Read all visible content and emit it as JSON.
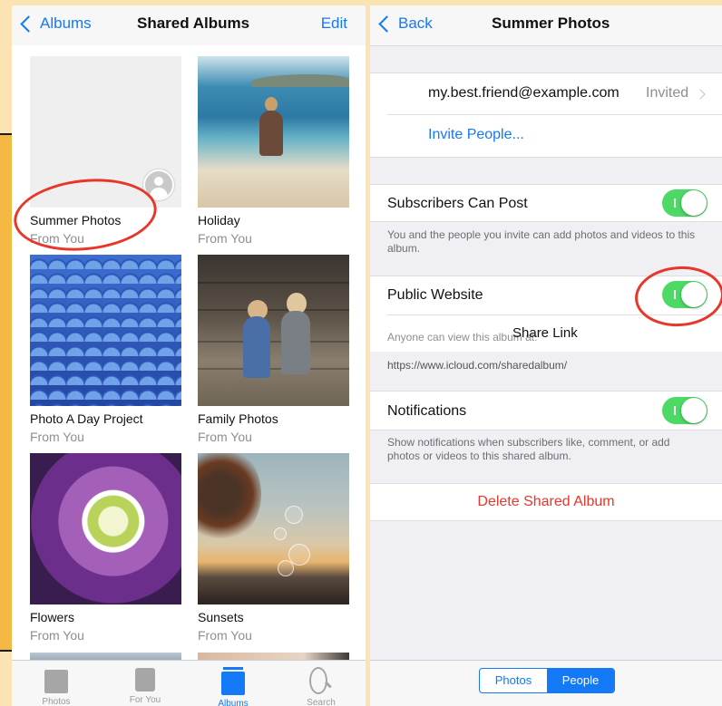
{
  "left": {
    "nav": {
      "back_label": "Albums",
      "title": "Shared Albums",
      "edit_label": "Edit"
    },
    "albums": [
      {
        "name": "Summer Photos",
        "owner": "From You"
      },
      {
        "name": "Holiday",
        "owner": "From You"
      },
      {
        "name": "Photo A Day Project",
        "owner": "From You"
      },
      {
        "name": "Family Photos",
        "owner": "From You"
      },
      {
        "name": "Flowers",
        "owner": "From You"
      },
      {
        "name": "Sunsets",
        "owner": "From You"
      }
    ],
    "tabs": [
      {
        "label": "Photos",
        "icon": "photos-icon"
      },
      {
        "label": "For You",
        "icon": "for-you-icon"
      },
      {
        "label": "Albums",
        "icon": "albums-icon",
        "active": true
      },
      {
        "label": "Search",
        "icon": "search-icon"
      }
    ]
  },
  "right": {
    "nav": {
      "back_label": "Back",
      "title": "Summer Photos"
    },
    "invitee": {
      "email": "my.best.friend@example.com",
      "status": "Invited"
    },
    "invite_label": "Invite People...",
    "subscribers_can_post": {
      "label": "Subscribers Can Post",
      "on": true,
      "footer": "You and the people you invite can add photos and videos to this album."
    },
    "public_website": {
      "label": "Public Website",
      "on": true,
      "footer": "Anyone can view this album at:",
      "share_link_label": "Share Link",
      "url": "https://www.icloud.com/sharedalbum/"
    },
    "notifications": {
      "label": "Notifications",
      "on": true,
      "footer": "Show notifications when subscribers like, comment, or add photos or videos to this shared album."
    },
    "delete_label": "Delete Shared Album",
    "segments": [
      {
        "label": "Photos",
        "selected": false
      },
      {
        "label": "People",
        "selected": true
      }
    ]
  },
  "colors": {
    "accent": "#1479f6",
    "toggle_on": "#4cd964",
    "destructive": "#e8372a",
    "annotation": "#e8372a"
  }
}
